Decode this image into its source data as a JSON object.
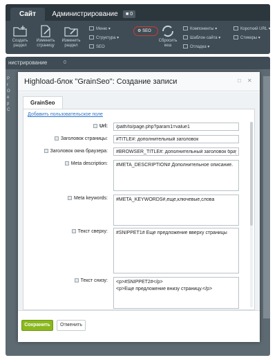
{
  "admin_panel": {
    "tabs": {
      "site": "Сайт",
      "admin": "Администрирование",
      "notifications": "0"
    },
    "big_buttons": [
      {
        "label": "Создать\nраздел",
        "icon": "folder-plus-icon"
      },
      {
        "label": "Изменить\nстраницу",
        "icon": "page-edit-icon"
      },
      {
        "label": "Изменить\nраздел",
        "icon": "folder-edit-icon"
      }
    ],
    "menu_col1": [
      "Меню",
      "Структура",
      "SEO"
    ],
    "seo_highlight": "SEO",
    "cache": {
      "label": "Сбросить\nкеш",
      "icon": "refresh-icon"
    },
    "menu_col2": [
      "Компоненты",
      "Шаблон сайта",
      "Отладка"
    ],
    "menu_col3": [
      "Короткий URL",
      "Стикеры"
    ]
  },
  "background": {
    "tab": "нистрирование",
    "badge": "0",
    "left_text": "P\nr\nO\nе\nр\nС"
  },
  "dialog": {
    "title": "Highload-блок \"GrainSeo\": Создание записи",
    "tab": "GrainSeo",
    "add_field_link": "Добавить пользовательское поле",
    "fields": {
      "url": {
        "label": "Url:",
        "value": "/path/to/page.php?param1=value1"
      },
      "title": {
        "label": "Заголовок страницы:",
        "value": "#TITLE#: дополнительный заголовок"
      },
      "browser_title": {
        "label": "Заголовок окна браузера:",
        "value": "#BROWSER_TITLE#: дополнительный заголовок браузера"
      },
      "meta_description": {
        "label": "Meta description:",
        "value": "#META_DESCRIPTION# Дополнительное описание."
      },
      "meta_keywords": {
        "label": "Meta keywords:",
        "value": "#META_KEYWORDS#,еще,ключевые,слова"
      },
      "text_top": {
        "label": "Текст сверху:",
        "value": "#SNIPPET1# Еще предложение вверху страницы"
      },
      "text_bottom": {
        "label": "Текст снизу:",
        "value": "<p>#SNIPPET2#</p>\n<p>Еще предложение внизу страницу.</p>"
      }
    },
    "buttons": {
      "save": "Сохранить",
      "cancel": "Отменить"
    }
  },
  "colors": {
    "panel": "#3f4c55",
    "save_button": "#8ab81d",
    "link": "#2a72c8",
    "seo_highlight": "#d03a2f"
  }
}
